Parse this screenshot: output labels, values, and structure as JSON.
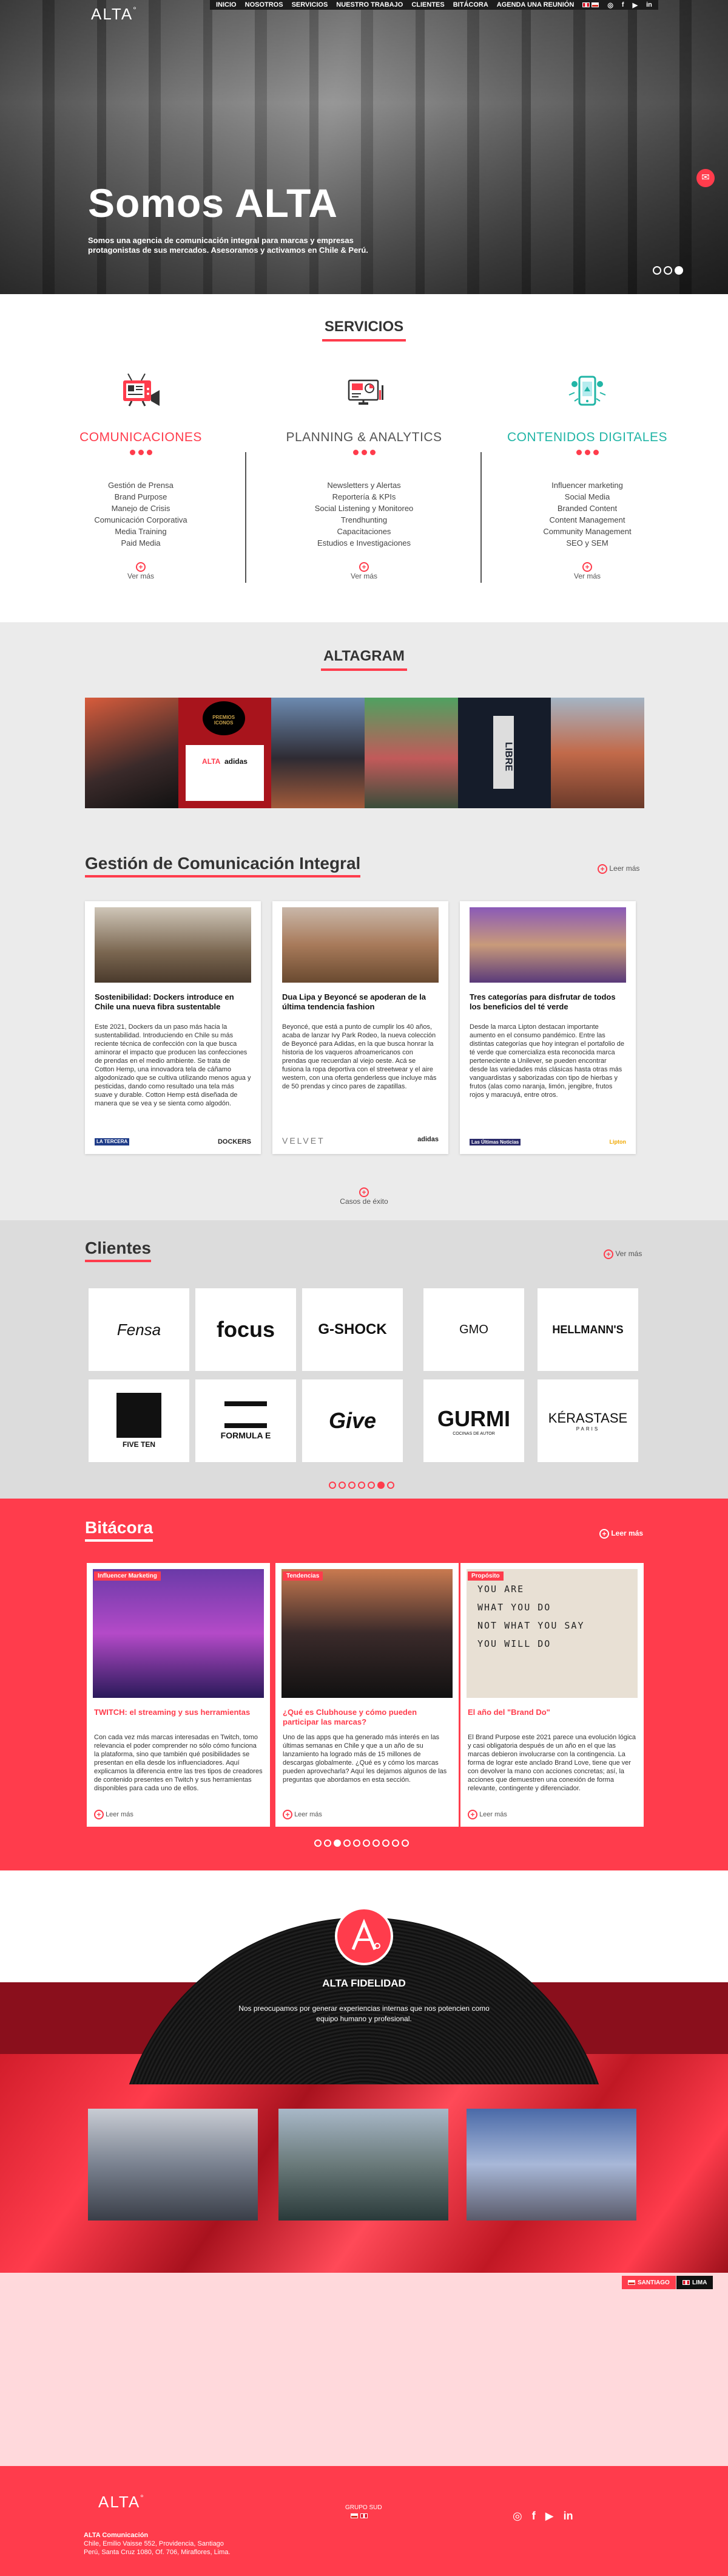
{
  "brand": {
    "logo": "ALTA",
    "logo_dot": "°"
  },
  "nav": {
    "items": [
      "INICIO",
      "NOSOTROS",
      "SERVICIOS",
      "NUESTRO TRABAJO",
      "CLIENTES",
      "BITÁCORA",
      "AGENDA UNA REUNIÓN"
    ],
    "social": [
      "instagram-icon",
      "facebook-icon",
      "youtube-icon",
      "linkedin-icon"
    ]
  },
  "hero": {
    "title": "Somos ALTA",
    "subtitle": "Somos una agencia de comunicación integral para marcas y empresas protagonistas de sus mercados. Asesoramos y activamos en Chile & Perú.",
    "slides": 3,
    "active_slide": 3
  },
  "servicios": {
    "title": "SERVICIOS",
    "columns": [
      {
        "name": "COMUNICACIONES",
        "color": "#ff3c4c",
        "items": [
          "Gestión de Prensa",
          "Brand Purpose",
          "Manejo de Crisis",
          "Comunicación Corporativa",
          "Media Training",
          "Paid Media"
        ],
        "more": "Ver más"
      },
      {
        "name": "PLANNING & ANALYTICS",
        "color": "#555555",
        "items": [
          "Newsletters y Alertas",
          "Reportería & KPIs",
          "Social Listening y Monitoreo",
          "Trendhunting",
          "Capacitaciones",
          "Estudios e Investigaciones"
        ],
        "more": "Ver más"
      },
      {
        "name": "CONTENIDOS DIGITALES",
        "color": "#21b5a6",
        "items": [
          "Influencer marketing",
          "Social Media",
          "Branded Content",
          "Content Management",
          "Community Management",
          "SEO y SEM"
        ],
        "more": "Ver más"
      }
    ]
  },
  "altagram": {
    "title": "ALTAGRAM",
    "tiles": [
      "#7a3b2a",
      "#c9b9a4",
      "#4b5e7a",
      "#b07a8c",
      "#1d2433",
      "#8a6b52"
    ],
    "tile_text": {
      "premios": "PREMIOS ICONOS",
      "alta": "ALTA",
      "adidas": "adidas",
      "libre": "LIBRE"
    }
  },
  "gestion": {
    "title": "Gestión de Comunicación Integral",
    "more": "Leer más",
    "cards": [
      {
        "title": "Sostenibilidad: Dockers introduce en Chile una nueva fibra sustentable",
        "body": "Este 2021, Dockers da un paso más hacia la sustentabilidad. Introduciendo en Chile su más reciente técnica de confección con la que busca aminorar el impacto que producen las confecciones de prendas en el medio ambiente. Se trata de Cotton Hemp, una innovadora tela de cáñamo algodonizado que se cultiva utilizando menos agua y pesticidas, dando como resultado una tela más suave y durable. Cotton Hemp está diseñada de manera que se vea y se sienta como algodón.",
        "brands": [
          "LA TERCERA",
          "DOCKERS"
        ]
      },
      {
        "title": "Dua Lipa y Beyoncé se apoderan de la última tendencia fashion",
        "body": "Beyoncé, que está a punto de cumplir los 40 años, acaba de lanzar Ivy Park Rodeo, la nueva colección de Beyoncé para Adidas, en la que busca honrar la historia de los vaqueros afroamericanos con prendas que recuerdan al viejo oeste. Acá se fusiona la ropa deportiva con el streetwear y el aire western, con una oferta genderless que incluye más de 50 prendas y cinco pares de zapatillas.",
        "brands": [
          "VELVET",
          "adidas"
        ]
      },
      {
        "title": "Tres categorías para disfrutar de todos los beneficios del té verde",
        "body": "Desde la marca Lipton destacan importante aumento en el consumo pandémico. Entre las distintas categorías que hoy integran el portafolio de té verde que comercializa esta reconocida marca perteneciente a Unilever, se pueden encontrar desde las variedades más clásicas hasta otras más vanguardistas y saborizadas con tipo de hierbas y frutos (alas como naranja, limón, jengibre, frutos rojos y maracuyá, entre otros.",
        "brands": [
          "Las Últimas Noticias",
          "Lipton"
        ]
      }
    ],
    "cases": "Casos de éxito"
  },
  "clientes": {
    "title": "Clientes",
    "more": "Ver más",
    "logos": [
      "Fensa",
      "focus",
      "G-SHOCK",
      "GMO",
      "HELLMANN'S",
      "FIVE TEN",
      "FORMULA E",
      "Give",
      "GURMI",
      "KÉRASTASE"
    ],
    "logo_sub": {
      "gurmi": "COCINAS DE AUTOR",
      "kerastase": "PARIS"
    },
    "pages": 7,
    "active_page": 6
  },
  "bitacora": {
    "title": "Bitácora",
    "more": "Leer más",
    "cards": [
      {
        "tag": "Influencer Marketing",
        "title": "TWITCH: el streaming y sus herramientas",
        "body": "Con cada vez más marcas interesadas en Twitch, tomo relevancia el poder comprender no sólo cómo funciona la plataforma, sino que también qué posibilidades se presentan en ella desde los influenciadores. Aquí explicamos la diferencia entre las tres tipos de creadores de contenido presentes en Twitch y sus herramientas disponibles para cada uno de ellos.",
        "more": "Leer más"
      },
      {
        "tag": "Tendencias",
        "title": "¿Qué es Clubhouse y cómo pueden participar las marcas?",
        "body": "Uno de las apps que ha generado más interés en las últimas semanas en Chile y que a un año de su lanzamiento ha logrado más de 15 millones de descargas globalmente. ¿Qué es y cómo los marcas pueden aprovecharla? Aquí les dejamos algunos de las preguntas que abordamos en esta sección.",
        "more": "Leer más"
      },
      {
        "tag": "Propósito",
        "title": "El año del \"Brand Do\"",
        "body": "El Brand Purpose este 2021 parece una evolución lógica y casi obligatoria después de un año en el que las marcas debieron involucrarse con la contingencia. La forma de lograr este anclado Brand Love, tiene que ver con devolver la mano con acciones concretas; así, la acciones que demuestren una conexión de forma relevante, contingente y diferenciador.",
        "more": "Leer más"
      }
    ],
    "quote_lines": [
      "YOU ARE",
      "WHAT YOU DO",
      "NOT WHAT YOU SAY",
      "YOU WILL DO"
    ],
    "pages": 10,
    "active_page": 3
  },
  "fidelidad": {
    "title": "ALTA FIDELIDAD",
    "subtitle": "Nos preocupamos por generar experiencias internas que nos potencien como equipo humano y profesional."
  },
  "locations": {
    "santiago": "SANTIAGO",
    "lima": "LIMA"
  },
  "footer": {
    "logo": "ALTA",
    "group": "GRUPO SUD",
    "company": "ALTA Comunicación",
    "address1": "Chile, Emilio Vaisse 552, Providencia, Santiago",
    "address2": "Perú, Santa Cruz 1080, Of. 706, Miraflores, Lima.",
    "social": [
      "instagram-icon",
      "facebook-icon",
      "youtube-icon",
      "linkedin-icon"
    ]
  },
  "colors": {
    "accent": "#ff3c4c",
    "teal": "#21b5a6",
    "dark": "#222222"
  }
}
